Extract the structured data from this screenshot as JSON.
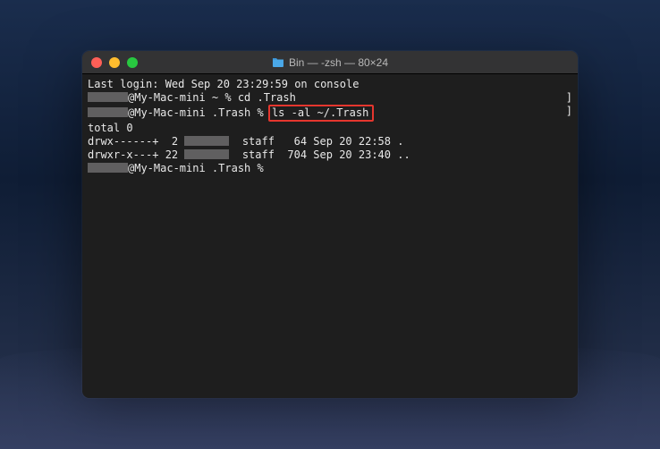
{
  "window": {
    "title": "Bin — -zsh — 80×24"
  },
  "terminal": {
    "last_login": "Last login: Wed Sep 20 23:29:59 on console",
    "prompt1_host": "@My-Mac-mini ~ % ",
    "prompt1_cmd": "cd .Trash",
    "prompt2_host": "@My-Mac-mini .Trash % ",
    "prompt2_cmd": "ls -al ~/.Trash",
    "out_total": "total 0",
    "out_row1_perm": "drwx------+  2 ",
    "out_row1_rest": "  staff   64 Sep 20 22:58 .",
    "out_row2_perm": "drwxr-x---+ 22 ",
    "out_row2_rest": "  staff  704 Sep 20 23:40 ..",
    "prompt3_host": "@My-Mac-mini .Trash % ",
    "bracket": "]"
  }
}
